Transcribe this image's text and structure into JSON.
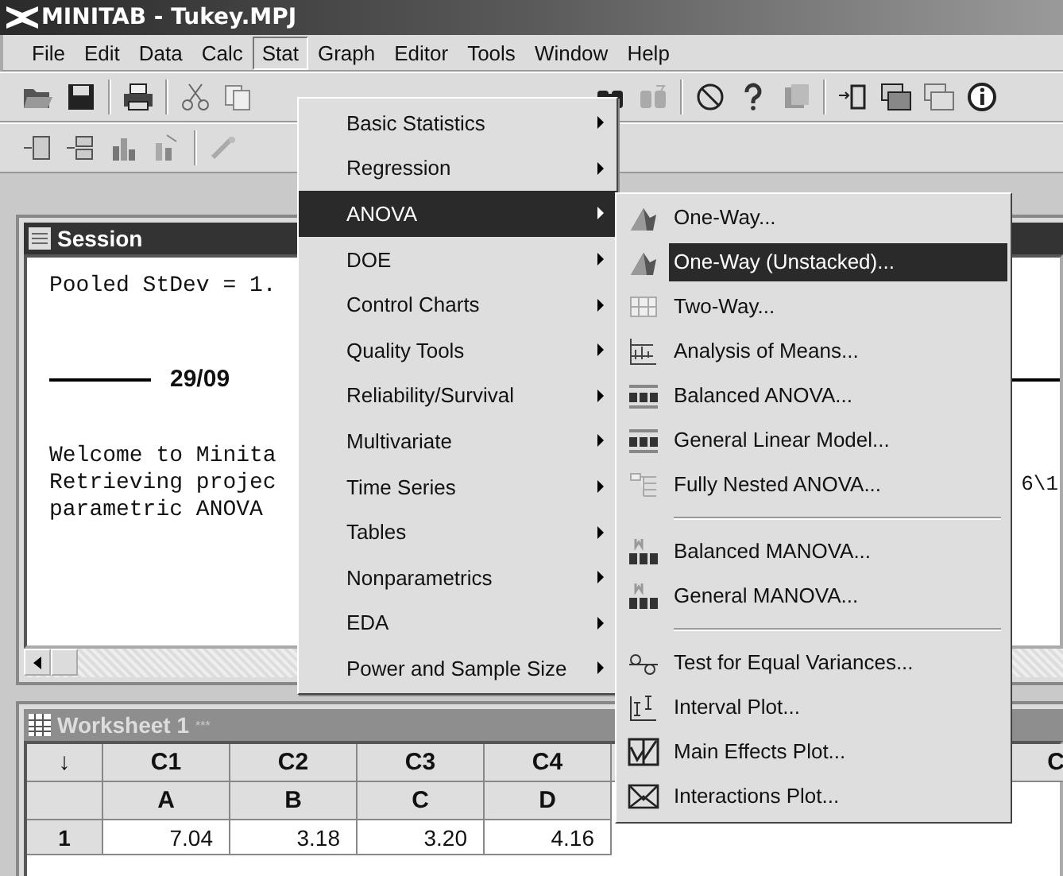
{
  "window": {
    "title": "MINITAB - Tukey.MPJ"
  },
  "menu_bar": [
    {
      "label": "File",
      "selected": false
    },
    {
      "label": "Edit",
      "selected": false
    },
    {
      "label": "Data",
      "selected": false
    },
    {
      "label": "Calc",
      "selected": false
    },
    {
      "label": "Stat",
      "selected": true
    },
    {
      "label": "Graph",
      "selected": false
    },
    {
      "label": "Editor",
      "selected": false
    },
    {
      "label": "Tools",
      "selected": false
    },
    {
      "label": "Window",
      "selected": false
    },
    {
      "label": "Help",
      "selected": false
    }
  ],
  "stat_menu": [
    {
      "label": "Basic Statistics",
      "selected": false
    },
    {
      "label": "Regression",
      "selected": false
    },
    {
      "label": "ANOVA",
      "selected": true
    },
    {
      "label": "DOE",
      "selected": false
    },
    {
      "label": "Control Charts",
      "selected": false
    },
    {
      "label": "Quality Tools",
      "selected": false
    },
    {
      "label": "Reliability/Survival",
      "selected": false
    },
    {
      "label": "Multivariate",
      "selected": false
    },
    {
      "label": "Time Series",
      "selected": false
    },
    {
      "label": "Tables",
      "selected": false
    },
    {
      "label": "Nonparametrics",
      "selected": false
    },
    {
      "label": "EDA",
      "selected": false
    },
    {
      "label": "Power and Sample Size",
      "selected": false
    }
  ],
  "anova_submenu": [
    {
      "kind": "item",
      "label": "One-Way...",
      "selected": false
    },
    {
      "kind": "item",
      "label": "One-Way (Unstacked)...",
      "selected": true
    },
    {
      "kind": "item",
      "label": "Two-Way...",
      "selected": false
    },
    {
      "kind": "item",
      "label": "Analysis of Means...",
      "selected": false
    },
    {
      "kind": "item",
      "label": "Balanced ANOVA...",
      "selected": false
    },
    {
      "kind": "item",
      "label": "General Linear Model...",
      "selected": false
    },
    {
      "kind": "item",
      "label": "Fully Nested ANOVA...",
      "selected": false
    },
    {
      "kind": "separator"
    },
    {
      "kind": "item",
      "label": "Balanced MANOVA...",
      "selected": false
    },
    {
      "kind": "item",
      "label": "General MANOVA...",
      "selected": false
    },
    {
      "kind": "separator"
    },
    {
      "kind": "item",
      "label": "Test for Equal Variances...",
      "selected": false
    },
    {
      "kind": "item",
      "label": "Interval Plot...",
      "selected": false
    },
    {
      "kind": "item",
      "label": "Main Effects Plot...",
      "selected": false
    },
    {
      "kind": "item",
      "label": "Interactions Plot...",
      "selected": false
    }
  ],
  "session": {
    "title": "Session",
    "stdev_line": "Pooled StDev = 1.",
    "date": "29/09",
    "lines": [
      {
        "left": "Welcome to Minita"
      },
      {
        "left": "Retrieving projec",
        "right": "6\\1"
      },
      {
        "left": "parametric ANOVA"
      }
    ]
  },
  "worksheet": {
    "title": "Worksheet 1",
    "modified": "***",
    "corner": "↓",
    "columns": [
      "C1",
      "C2",
      "C3",
      "C4",
      "C"
    ],
    "names": [
      "A",
      "B",
      "C",
      "D"
    ],
    "rows": [
      {
        "number": "1",
        "cells": [
          "7.04",
          "3.18",
          "3.20",
          "4.16"
        ]
      }
    ]
  }
}
